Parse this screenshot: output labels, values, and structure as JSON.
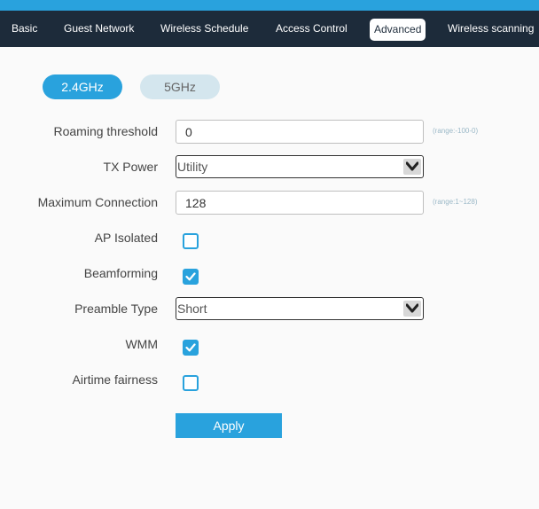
{
  "nav": {
    "tabs": [
      {
        "label": "Basic"
      },
      {
        "label": "Guest Network"
      },
      {
        "label": "Wireless Schedule"
      },
      {
        "label": "Access Control"
      },
      {
        "label": "Advanced",
        "active": true
      },
      {
        "label": "Wireless scanning"
      }
    ]
  },
  "bands": {
    "band_24": "2.4GHz",
    "band_5": "5GHz",
    "selected": "2.4GHz"
  },
  "form": {
    "roaming_threshold": {
      "label": "Roaming threshold",
      "value": "0",
      "hint": "(range:-100-0)"
    },
    "tx_power": {
      "label": "TX Power",
      "value": "Utility"
    },
    "max_connection": {
      "label": "Maximum Connection",
      "value": "128",
      "hint": "(range:1~128)"
    },
    "ap_isolated": {
      "label": "AP Isolated",
      "checked": false
    },
    "beamforming": {
      "label": "Beamforming",
      "checked": true
    },
    "preamble_type": {
      "label": "Preamble Type",
      "value": "Short"
    },
    "wmm": {
      "label": "WMM",
      "checked": true
    },
    "airtime_fairness": {
      "label": "Airtime fairness",
      "checked": false
    }
  },
  "apply_label": "Apply",
  "colors": {
    "accent": "#29a2dd",
    "nav_background": "#1d2b3a",
    "band_inactive": "#d4e6ee",
    "hint_text": "#9cb9c8"
  },
  "icons": {
    "select_arrow": "chevron-down-icon",
    "checkbox_checked": "check-icon"
  }
}
